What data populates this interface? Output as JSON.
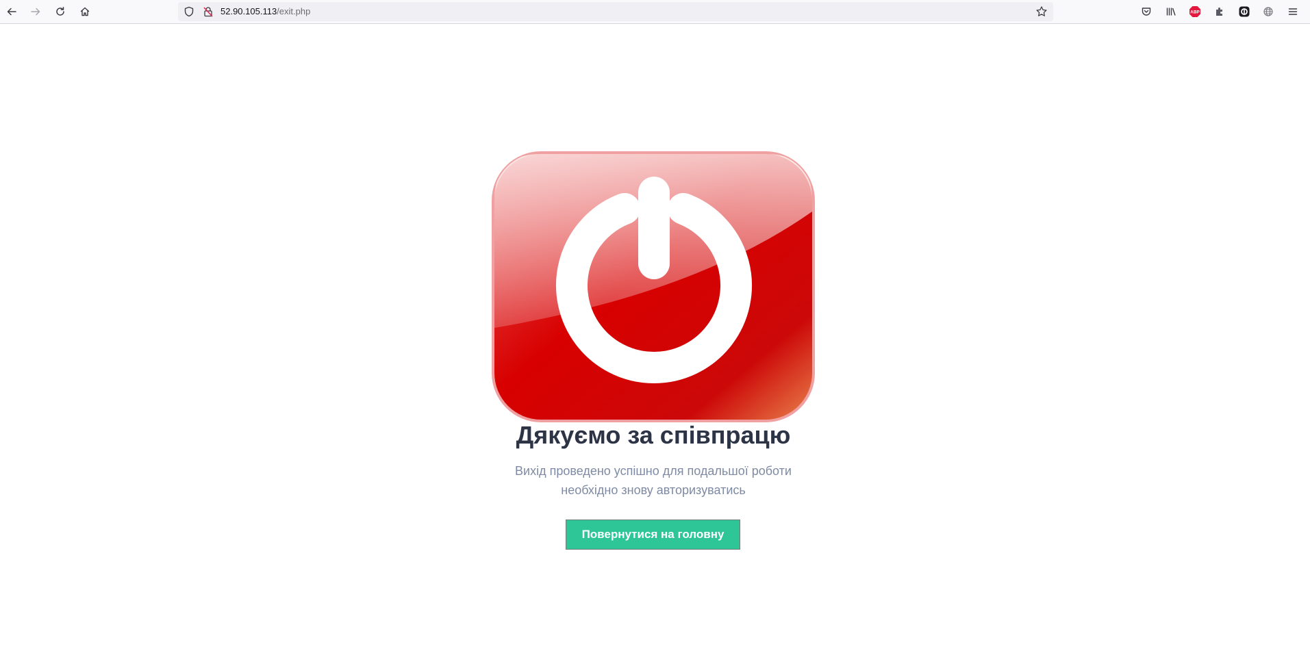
{
  "browser": {
    "url_host": "52.90.105.113",
    "url_path": "/exit.php",
    "icons": {
      "back": "back-arrow-icon",
      "forward": "forward-arrow-icon",
      "reload": "reload-icon",
      "home": "home-icon",
      "tracking": "shield-icon",
      "insecure": "insecure-lock-icon",
      "bookmark": "star-icon",
      "pocket": "pocket-icon",
      "library": "library-icon",
      "adblock": "adblock-icon",
      "extension": "extension-icon",
      "extension2": "extension-icon",
      "globe": "globe-icon",
      "menu": "hamburger-menu-icon"
    },
    "adblock_label": "ABP"
  },
  "page": {
    "title": "Дякуємо за співпрацю",
    "message_line1": "Вихід проведено успішно для подальшої роботи",
    "message_line2": "необхідно знову авторизуватись",
    "button_label": "Повернутися на головну",
    "colors": {
      "icon_red": "#d40000",
      "button": "#2ec597",
      "title": "#2d3446",
      "subtitle": "#7e8aa3"
    }
  }
}
